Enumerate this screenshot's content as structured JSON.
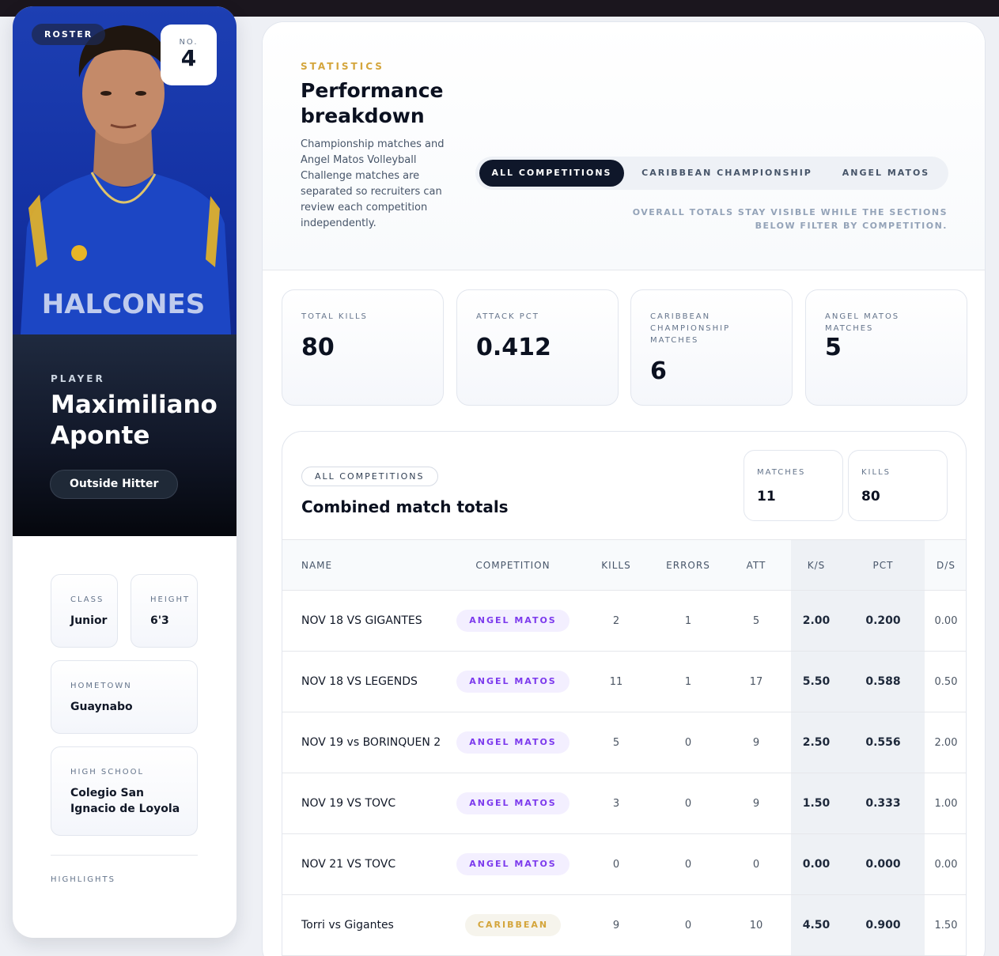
{
  "player": {
    "roster_label": "ROSTER",
    "number_label": "NO.",
    "number": "4",
    "role_kicker": "PLAYER",
    "name": "Maximiliano Aponte",
    "position": "Outside Hitter",
    "class_label": "CLASS",
    "class_value": "Junior",
    "height_label": "HEIGHT",
    "height_value": "6'3",
    "hometown_label": "HOMETOWN",
    "hometown_value": "Guaynabo",
    "school_label": "HIGH SCHOOL",
    "school_value": "Colegio San Ignacio de Loyola",
    "highlights_label": "HIGHLIGHTS",
    "jersey_text": "HALCONES"
  },
  "stats": {
    "kicker": "STATISTICS",
    "title": "Performance breakdown",
    "description": "Championship matches and Angel Matos Volleyball Challenge matches are separated so recruiters can review each competition independently.",
    "tabs": [
      "ALL COMPETITIONS",
      "CARIBBEAN CHAMPIONSHIP",
      "ANGEL MATOS"
    ],
    "active_tab": "ALL COMPETITIONS",
    "tab_note": "OVERALL TOTALS STAY VISIBLE WHILE THE SECTIONS BELOW FILTER BY COMPETITION.",
    "cards": [
      {
        "label": "TOTAL KILLS",
        "value": "80"
      },
      {
        "label": "ATTACK PCT",
        "value": "0.412"
      },
      {
        "label": "CARIBBEAN CHAMPIONSHIP MATCHES",
        "value": "6"
      },
      {
        "label": "ANGEL MATOS MATCHES",
        "value": "5"
      }
    ]
  },
  "totals": {
    "chip": "ALL COMPETITIONS",
    "title": "Combined match totals",
    "matches_label": "MATCHES",
    "matches_value": "11",
    "kills_label": "KILLS",
    "kills_value": "80",
    "columns": [
      "NAME",
      "COMPETITION",
      "KILLS",
      "ERRORS",
      "ATT",
      "K/S",
      "PCT",
      "D/S"
    ],
    "rows": [
      {
        "name": "NOV 18 VS GIGANTES",
        "competition": "ANGEL MATOS",
        "kills": "2",
        "errors": "1",
        "att": "5",
        "ks": "2.00",
        "pct": "0.200",
        "ds": "0.00"
      },
      {
        "name": "NOV 18 VS LEGENDS",
        "competition": "ANGEL MATOS",
        "kills": "11",
        "errors": "1",
        "att": "17",
        "ks": "5.50",
        "pct": "0.588",
        "ds": "0.50"
      },
      {
        "name": "NOV 19 vs BORINQUEN 2",
        "competition": "ANGEL MATOS",
        "kills": "5",
        "errors": "0",
        "att": "9",
        "ks": "2.50",
        "pct": "0.556",
        "ds": "2.00"
      },
      {
        "name": "NOV 19 VS TOVC",
        "competition": "ANGEL MATOS",
        "kills": "3",
        "errors": "0",
        "att": "9",
        "ks": "1.50",
        "pct": "0.333",
        "ds": "1.00"
      },
      {
        "name": "NOV 21 VS TOVC",
        "competition": "ANGEL MATOS",
        "kills": "0",
        "errors": "0",
        "att": "0",
        "ks": "0.00",
        "pct": "0.000",
        "ds": "0.00"
      },
      {
        "name": "Torri vs Gigantes",
        "competition": "CARIBBEAN",
        "kills": "9",
        "errors": "0",
        "att": "10",
        "ks": "4.50",
        "pct": "0.900",
        "ds": "1.50"
      }
    ]
  },
  "colors": {
    "accent_gold": "#d4a53b",
    "accent_purple": "#7c3aed",
    "dark": "#0f172a",
    "photo_blue": "#1432a4"
  }
}
